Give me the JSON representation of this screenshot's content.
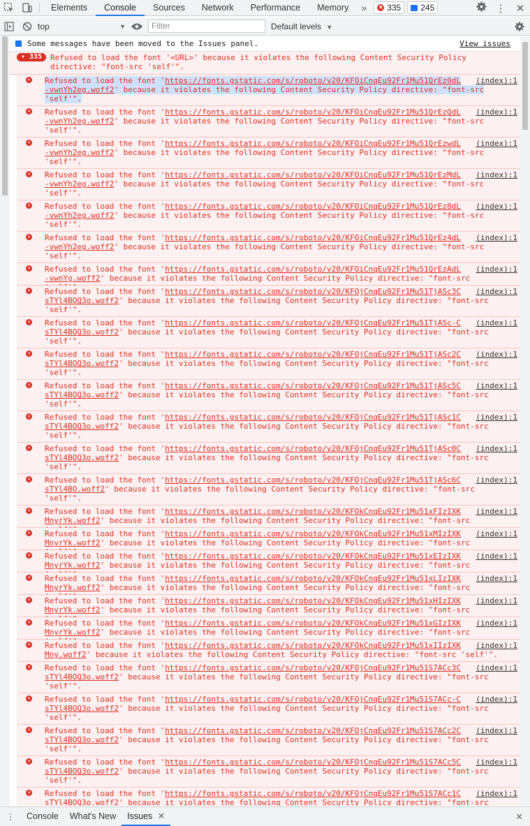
{
  "tabs": [
    "Elements",
    "Console",
    "Sources",
    "Network",
    "Performance",
    "Memory"
  ],
  "active_tab": "Console",
  "more_tabs": "»",
  "error_count": "335",
  "message_count": "245",
  "toolbar": {
    "context": "top",
    "filter_placeholder": "Filter",
    "levels": "Default levels"
  },
  "info": {
    "text": "Some messages have been moved to the Issues panel.",
    "link": "View issues"
  },
  "group": {
    "count": "335",
    "line1": "Refused to load the font '<URL>' because it violates the following Content Security Policy",
    "line2": "directive: \"font-src 'self'\"."
  },
  "messages": [
    {
      "prefix": "Refused to load the font '",
      "url": "https://fonts.gstatic.com/s/roboto/v20/KFOiCnqEu92Fr1Mu51QrEz0dL",
      "src": "(index):1",
      "l2": "-vwnYh2eg.woff2",
      "l2rest": "' because it violates the following Content Security Policy directive: \"font-src",
      "l3": "'self'\"."
    },
    {
      "prefix": "Refused to load the font '",
      "url": "https://fonts.gstatic.com/s/roboto/v20/KFOiCnqEu92Fr1Mu51QrEzQdL",
      "src": "(index):1",
      "l2": "-vwnYh2eg.woff2",
      "l2rest": "' because it violates the following Content Security Policy directive: \"font-src",
      "l3": "'self'\"."
    },
    {
      "prefix": "Refused to load the font '",
      "url": "https://fonts.gstatic.com/s/roboto/v20/KFOiCnqEu92Fr1Mu51QrEzwdL",
      "src": "(index):1",
      "l2": "-vwnYh2eg.woff2",
      "l2rest": "' because it violates the following Content Security Policy directive: \"font-src",
      "l3": "'self'\"."
    },
    {
      "prefix": "Refused to load the font '",
      "url": "https://fonts.gstatic.com/s/roboto/v20/KFOiCnqEu92Fr1Mu51QrEzMdL",
      "src": "(index):1",
      "l2": "-vwnYh2eg.woff2",
      "l2rest": "' because it violates the following Content Security Policy directive: \"font-src",
      "l3": "'self'\"."
    },
    {
      "prefix": "Refused to load the font '",
      "url": "https://fonts.gstatic.com/s/roboto/v20/KFOiCnqEu92Fr1Mu51QrEz8dL",
      "src": "(index):1",
      "l2": "-vwnYh2eg.woff2",
      "l2rest": "' because it violates the following Content Security Policy directive: \"font-src",
      "l3": "'self'\"."
    },
    {
      "prefix": "Refused to load the font '",
      "url": "https://fonts.gstatic.com/s/roboto/v20/KFOiCnqEu92Fr1Mu51QrEz4dL",
      "src": "(index):1",
      "l2": "-vwnYh2eg.woff2",
      "l2rest": "' because it violates the following Content Security Policy directive: \"font-src",
      "l3": "'self'\"."
    },
    {
      "prefix": "Refused to load the font '",
      "url": "https://fonts.gstatic.com/s/roboto/v20/KFOiCnqEu92Fr1Mu51QrEzAdL",
      "src": "(index):1",
      "l2": "-vwnYg.woff2",
      "l2rest": "' because it violates the following Content Security Policy directive: \"font-src 'self'\".",
      "l3": ""
    },
    {
      "prefix": "Refused to load the font '",
      "url": "https://fonts.gstatic.com/s/roboto/v20/KFOjCnqEu92Fr1Mu51TjASc3C",
      "src": "(index):1",
      "l2": "sTYl4BOQ3o.woff2",
      "l2rest": "' because it violates the following Content Security Policy directive: \"font-src",
      "l3": "'self'\"."
    },
    {
      "prefix": "Refused to load the font '",
      "url": "https://fonts.gstatic.com/s/roboto/v20/KFOjCnqEu92Fr1Mu51TjASc-C",
      "src": "(index):1",
      "l2": "sTYl4BOQ3o.woff2",
      "l2rest": "' because it violates the following Content Security Policy directive: \"font-src",
      "l3": "'self'\"."
    },
    {
      "prefix": "Refused to load the font '",
      "url": "https://fonts.gstatic.com/s/roboto/v20/KFOjCnqEu92Fr1Mu51TjASc2C",
      "src": "(index):1",
      "l2": "sTYl4BOQ3o.woff2",
      "l2rest": "' because it violates the following Content Security Policy directive: \"font-src",
      "l3": "'self'\"."
    },
    {
      "prefix": "Refused to load the font '",
      "url": "https://fonts.gstatic.com/s/roboto/v20/KFOjCnqEu92Fr1Mu51TjASc5C",
      "src": "(index):1",
      "l2": "sTYl4BOQ3o.woff2",
      "l2rest": "' because it violates the following Content Security Policy directive: \"font-src",
      "l3": "'self'\"."
    },
    {
      "prefix": "Refused to load the font '",
      "url": "https://fonts.gstatic.com/s/roboto/v20/KFOjCnqEu92Fr1Mu51TjASc1C",
      "src": "(index):1",
      "l2": "sTYl4BOQ3o.woff2",
      "l2rest": "' because it violates the following Content Security Policy directive: \"font-src",
      "l3": "'self'\"."
    },
    {
      "prefix": "Refused to load the font '",
      "url": "https://fonts.gstatic.com/s/roboto/v20/KFOjCnqEu92Fr1Mu51TjASc0C",
      "src": "(index):1",
      "l2": "sTYl4BOQ3o.woff2",
      "l2rest": "' because it violates the following Content Security Policy directive: \"font-src",
      "l3": "'self'\"."
    },
    {
      "prefix": "Refused to load the font '",
      "url": "https://fonts.gstatic.com/s/roboto/v20/KFOjCnqEu92Fr1Mu51TjASc6C",
      "src": "(index):1",
      "l2": "sTYl4BO.woff2",
      "l2rest": "' because it violates the following Content Security Policy directive: \"font-src",
      "l3": "'self'\"."
    },
    {
      "prefix": "Refused to load the font '",
      "url": "https://fonts.gstatic.com/s/roboto/v20/KFOkCnqEu92Fr1Mu51xFIzIXK",
      "src": "(index):1",
      "l2": "MnyrYk.woff2",
      "l2rest": "' because it violates the following Content Security Policy directive: \"font-src 'self'\".",
      "l3": ""
    },
    {
      "prefix": "Refused to load the font '",
      "url": "https://fonts.gstatic.com/s/roboto/v20/KFOkCnqEu92Fr1Mu51xMIzIXK",
      "src": "(index):1",
      "l2": "MnyrYk.woff2",
      "l2rest": "' because it violates the following Content Security Policy directive: \"font-src 'self'\".",
      "l3": ""
    },
    {
      "prefix": "Refused to load the font '",
      "url": "https://fonts.gstatic.com/s/roboto/v20/KFOkCnqEu92Fr1Mu51xEIzIXK",
      "src": "(index):1",
      "l2": "MnyrYk.woff2",
      "l2rest": "' because it violates the following Content Security Policy directive: \"font-src 'self'\".",
      "l3": ""
    },
    {
      "prefix": "Refused to load the font '",
      "url": "https://fonts.gstatic.com/s/roboto/v20/KFOkCnqEu92Fr1Mu51xLIzIXK",
      "src": "(index):1",
      "l2": "MnyrYk.woff2",
      "l2rest": "' because it violates the following Content Security Policy directive: \"font-src 'self'\".",
      "l3": ""
    },
    {
      "prefix": "Refused to load the font '",
      "url": "https://fonts.gstatic.com/s/roboto/v20/KFOkCnqEu92Fr1Mu51xHIzIXK",
      "src": "(index):1",
      "l2": "MnyrYk.woff2",
      "l2rest": "' because it violates the following Content Security Policy directive: \"font-src 'self'\".",
      "l3": ""
    },
    {
      "prefix": "Refused to load the font '",
      "url": "https://fonts.gstatic.com/s/roboto/v20/KFOkCnqEu92Fr1Mu51xGIzIXK",
      "src": "(index):1",
      "l2": "MnyrYk.woff2",
      "l2rest": "' because it violates the following Content Security Policy directive: \"font-src 'self'\".",
      "l3": ""
    },
    {
      "prefix": "Refused to load the font '",
      "url": "https://fonts.gstatic.com/s/roboto/v20/KFOkCnqEu92Fr1Mu51xIIzIXK",
      "src": "(index):1",
      "l2": "Mny.woff2",
      "l2rest": "' because it violates the following Content Security Policy directive: \"font-src 'self'\".",
      "l3": ""
    },
    {
      "prefix": "Refused to load the font '",
      "url": "https://fonts.gstatic.com/s/roboto/v20/KFOjCnqEu92Fr1Mu51S7ACc3C",
      "src": "(index):1",
      "l2": "sTYl4BOQ3o.woff2",
      "l2rest": "' because it violates the following Content Security Policy directive: \"font-src",
      "l3": "'self'\"."
    },
    {
      "prefix": "Refused to load the font '",
      "url": "https://fonts.gstatic.com/s/roboto/v20/KFOjCnqEu92Fr1Mu51S7ACc-C",
      "src": "(index):1",
      "l2": "sTYl4BOQ3o.woff2",
      "l2rest": "' because it violates the following Content Security Policy directive: \"font-src",
      "l3": "'self'\"."
    },
    {
      "prefix": "Refused to load the font '",
      "url": "https://fonts.gstatic.com/s/roboto/v20/KFOjCnqEu92Fr1Mu51S7ACc2C",
      "src": "(index):1",
      "l2": "sTYl4BOQ3o.woff2",
      "l2rest": "' because it violates the following Content Security Policy directive: \"font-src",
      "l3": "'self'\"."
    },
    {
      "prefix": "Refused to load the font '",
      "url": "https://fonts.gstatic.com/s/roboto/v20/KFOjCnqEu92Fr1Mu51S7ACc5C",
      "src": "(index):1",
      "l2": "sTYl4BOQ3o.woff2",
      "l2rest": "' because it violates the following Content Security Policy directive: \"font-src",
      "l3": "'self'\"."
    },
    {
      "prefix": "Refused to load the font '",
      "url": "https://fonts.gstatic.com/s/roboto/v20/KFOjCnqEu92Fr1Mu51S7ACc1C",
      "src": "(index):1",
      "l2": "sTYl4BOQ3o.woff2",
      "l2rest": "' because it violates the following Content Security Policy directive: \"font-src",
      "l3": "'self'\"."
    }
  ],
  "drawer_tabs": [
    "Console",
    "What's New",
    "Issues"
  ],
  "drawer_active": "Issues"
}
